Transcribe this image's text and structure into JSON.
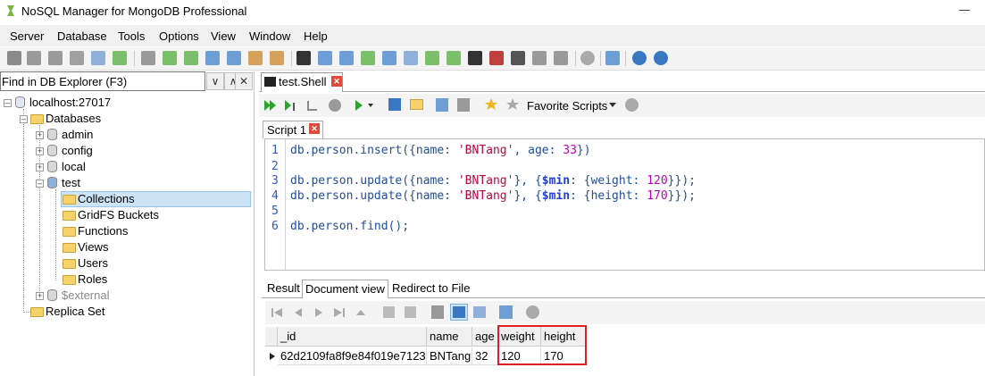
{
  "window": {
    "title": "NoSQL Manager for MongoDB Professional"
  },
  "menu": [
    "Server",
    "Database",
    "Tools",
    "Options",
    "View",
    "Window",
    "Help"
  ],
  "explorer": {
    "find_label": "Find in DB Explorer (F3)",
    "tree": {
      "root": "localhost:27017",
      "databases": "Databases",
      "admin": "admin",
      "config": "config",
      "local": "local",
      "test": "test",
      "collections": "Collections",
      "gridfs": "GridFS Buckets",
      "functions": "Functions",
      "views": "Views",
      "users": "Users",
      "roles": "Roles",
      "external": "$external",
      "replica": "Replica Set"
    }
  },
  "editor": {
    "tab": "test.Shell",
    "favorite_scripts": "Favorite Scripts",
    "script_tab": "Script 1",
    "line_numbers": [
      "1",
      "2",
      "3",
      "4",
      "5",
      "6"
    ]
  },
  "results": {
    "tabs": [
      "Result",
      "Document view",
      "Redirect to File"
    ],
    "columns": [
      "_id",
      "name",
      "age",
      "weight",
      "height"
    ],
    "rows": [
      [
        "62d2109fa8f9e84f019e7123",
        "BNTang",
        "32",
        "120",
        "170"
      ]
    ]
  }
}
